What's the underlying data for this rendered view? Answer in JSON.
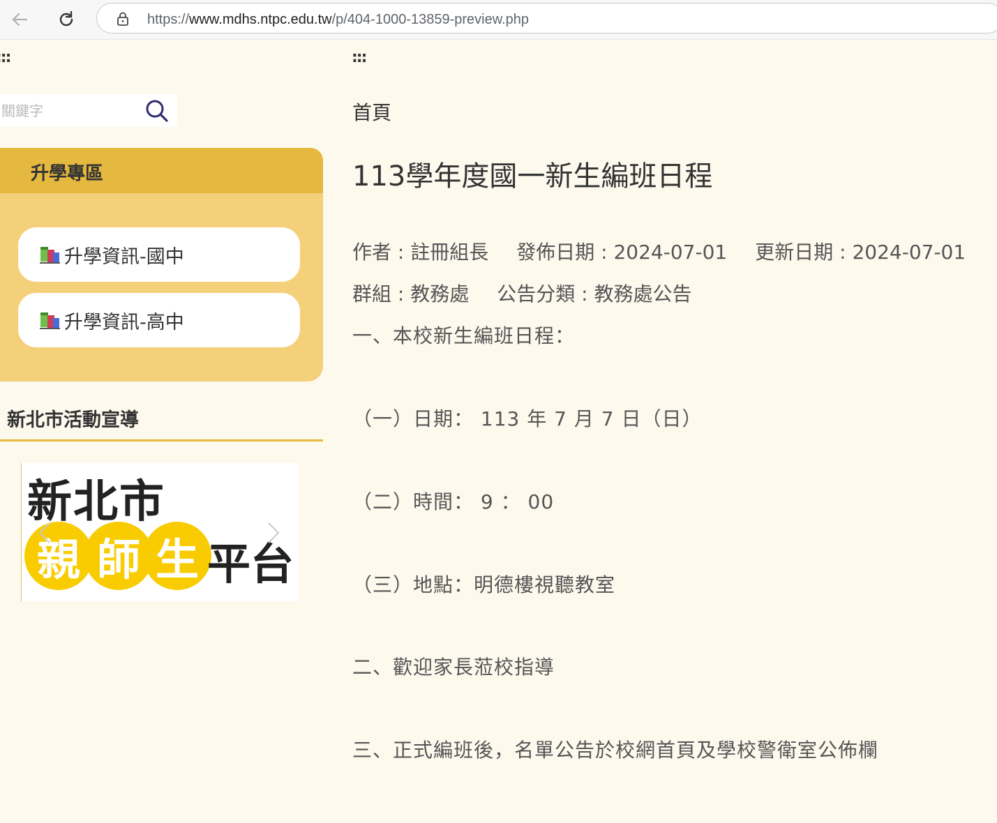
{
  "browser": {
    "url_scheme": "https://",
    "url_host": "www.mdhs.ntpc.edu.tw",
    "url_path": "/p/404-1000-13859-preview.php"
  },
  "left": {
    "accesskey": ":::",
    "search_placeholder": "關鍵字",
    "zone": {
      "title": "升學專區",
      "items": [
        {
          "label": "升學資訊-國中"
        },
        {
          "label": "升學資訊-高中"
        }
      ]
    },
    "promo": {
      "title": "新北市活動宣導",
      "banner_top": "新北市",
      "banner_chars": [
        "親",
        "師",
        "生"
      ],
      "banner_tail": "平台"
    }
  },
  "main": {
    "accesskey": ":::",
    "breadcrumb": "首頁",
    "title": "113學年度國一新生編班日程",
    "meta1": {
      "author": "作者 : 註冊組長",
      "published": "發佈日期 : 2024-07-01",
      "updated": "更新日期 : 2024-07-01"
    },
    "meta2": {
      "group": "群組 : 教務處",
      "category": "公告分類 : 教務處公告"
    },
    "content": [
      "一、本校新生編班日程：",
      "（一）日期： 113 年 7 月 7 日（日）",
      "（二）時間： 9 ： 00",
      "（三）地點：明德樓視聽教室",
      "二、歡迎家長蒞校指導",
      "三、正式編班後，名單公告於校網首頁及學校警衛室公佈欄"
    ]
  },
  "colors": {
    "page_bg": "#fdf9ed",
    "zone_head": "#e5b83f",
    "zone_body": "#f4d07a",
    "banner_yellow": "#f8cc00"
  }
}
